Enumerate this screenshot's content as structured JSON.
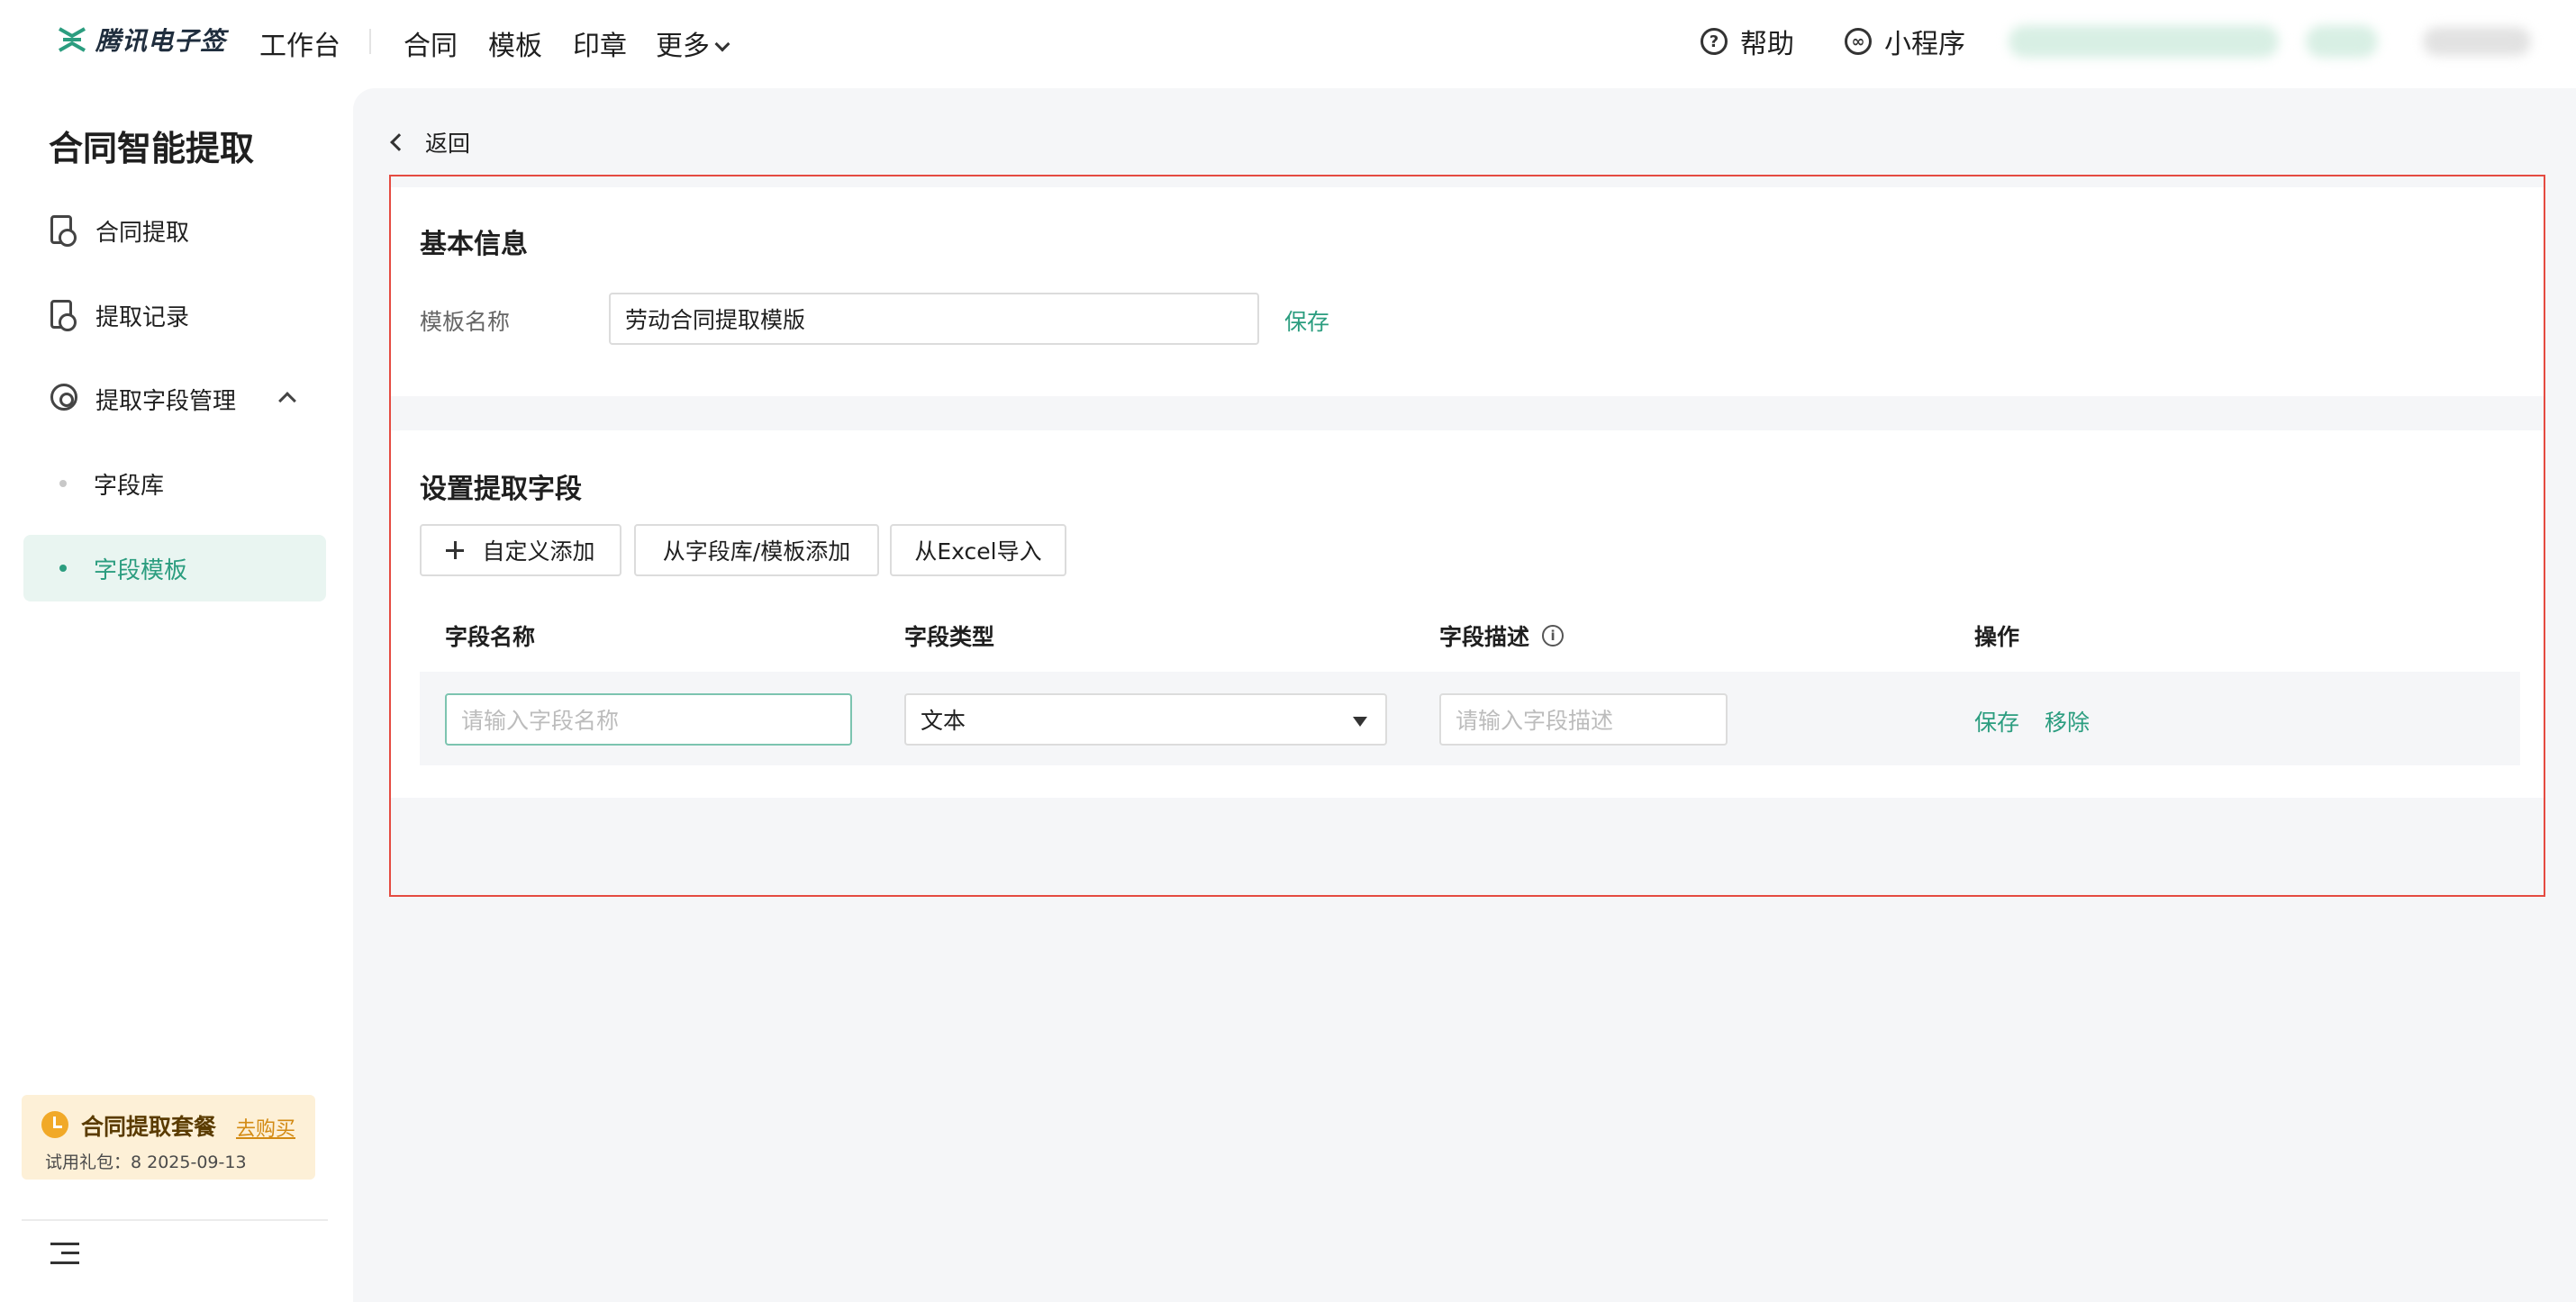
{
  "brand": {
    "name": "腾讯电子签",
    "accent": "#2b9d7f"
  },
  "topnav": {
    "workbench": "工作台",
    "items": [
      "合同",
      "模板",
      "印章"
    ],
    "more": "更多",
    "help": "帮助",
    "miniprogram": "小程序"
  },
  "sidebar": {
    "title": "合同智能提取",
    "items": [
      {
        "label": "合同提取",
        "icon": "document-icon"
      },
      {
        "label": "提取记录",
        "icon": "document-icon"
      },
      {
        "label": "提取字段管理",
        "icon": "settings-icon",
        "expanded": true
      }
    ],
    "sub_items": [
      {
        "label": "字段库",
        "active": false
      },
      {
        "label": "字段模板",
        "active": true
      }
    ],
    "plan": {
      "title": "合同提取套餐",
      "link": "去购买",
      "info": "试用礼包：8   2025-09-13"
    }
  },
  "main": {
    "back_label": "返回",
    "basic_info": {
      "title": "基本信息",
      "name_label": "模板名称",
      "name_value": "劳动合同提取模版",
      "save_label": "保存"
    },
    "fields": {
      "title": "设置提取字段",
      "buttons": {
        "custom_add": "自定义添加",
        "from_library": "从字段库/模板添加",
        "from_excel": "从Excel导入"
      },
      "columns": {
        "name": "字段名称",
        "type": "字段类型",
        "desc": "字段描述",
        "ops": "操作"
      },
      "row": {
        "name_placeholder": "请输入字段名称",
        "type_value": "文本",
        "desc_placeholder": "请输入字段描述",
        "save": "保存",
        "remove": "移除"
      }
    }
  }
}
